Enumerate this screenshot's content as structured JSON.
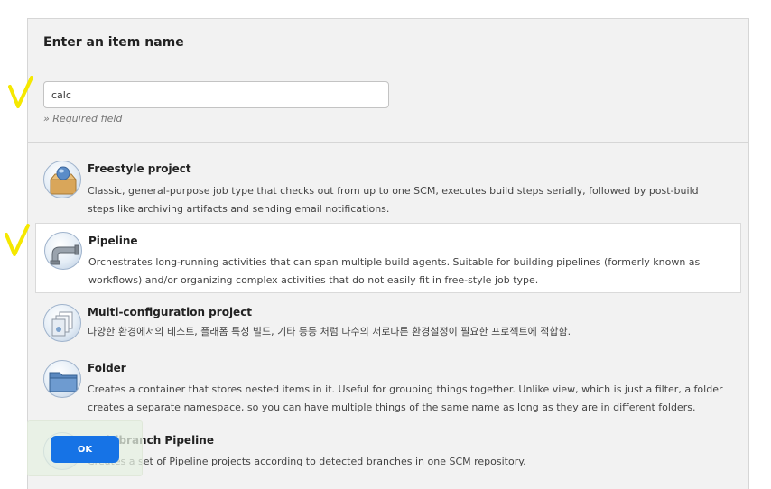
{
  "header": {
    "title": "Enter an item name",
    "input_value": "calc",
    "required_hint": "» Required field"
  },
  "items": [
    {
      "icon": "freestyle-box-icon",
      "name": "Freestyle project",
      "desc": "Classic, general-purpose job type that checks out from up to one SCM, executes build steps serially, followed by post-build steps like archiving artifacts and sending email notifications.",
      "selected": false
    },
    {
      "icon": "pipeline-pipe-icon",
      "name": "Pipeline",
      "desc": "Orchestrates long-running activities that can span multiple build agents. Suitable for building pipelines (formerly known as workflows) and/or organizing complex activities that do not easily fit in free-style job type.",
      "selected": true
    },
    {
      "icon": "multi-config-icon",
      "name": "Multi-configuration project",
      "desc": "다양한 환경에서의 테스트, 플래폼 특성 빌드, 기타 등등 처럼 다수의 서로다른 환경설정이 필요한 프로젝트에 적합함.",
      "selected": false
    },
    {
      "icon": "folder-icon",
      "name": "Folder",
      "desc": "Creates a container that stores nested items in it. Useful for grouping things together. Unlike view, which is just a filter, a folder creates a separate namespace, so you can have multiple things of the same name as long as they are in different folders.",
      "selected": false
    },
    {
      "icon": "multibranch-icon",
      "name": "Multibranch Pipeline",
      "desc": "Creates a set of Pipeline projects according to detected branches in one SCM repository.",
      "selected": false
    }
  ],
  "ok_label": "OK",
  "colors": {
    "accent": "#1673e6",
    "annotation": "#f5e800"
  }
}
